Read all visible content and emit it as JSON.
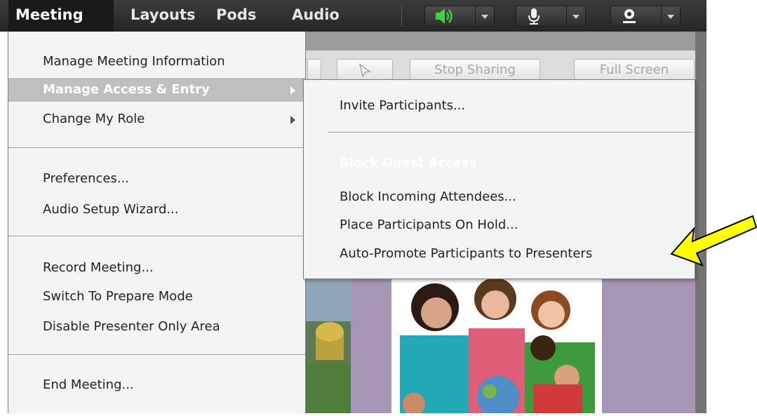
{
  "menubar": {
    "items": [
      "Meeting",
      "Layouts",
      "Pods",
      "Audio"
    ],
    "icons": {
      "speaker": "speaker-icon",
      "microphone": "microphone-icon",
      "webcam": "webcam-icon"
    },
    "speaker_color": "#3ed23e"
  },
  "background": {
    "buttons": [
      "Stop Sharing",
      "Full Screen"
    ]
  },
  "meeting_menu": {
    "items": [
      "Manage Meeting Information",
      "Manage Access & Entry",
      "Change My Role",
      "Preferences...",
      "Audio Setup Wizard...",
      "Record Meeting...",
      "Switch To Prepare Mode",
      "Disable Presenter Only Area",
      "End Meeting..."
    ]
  },
  "submenu": {
    "items": [
      "Invite Participants...",
      "Block Guest Access",
      "Block Incoming Attendees...",
      "Place Participants On Hold...",
      "Auto-Promote Participants to Presenters"
    ]
  },
  "annotation": {
    "arrow_color": "#ffff00",
    "arrow_outline": "#000000"
  }
}
